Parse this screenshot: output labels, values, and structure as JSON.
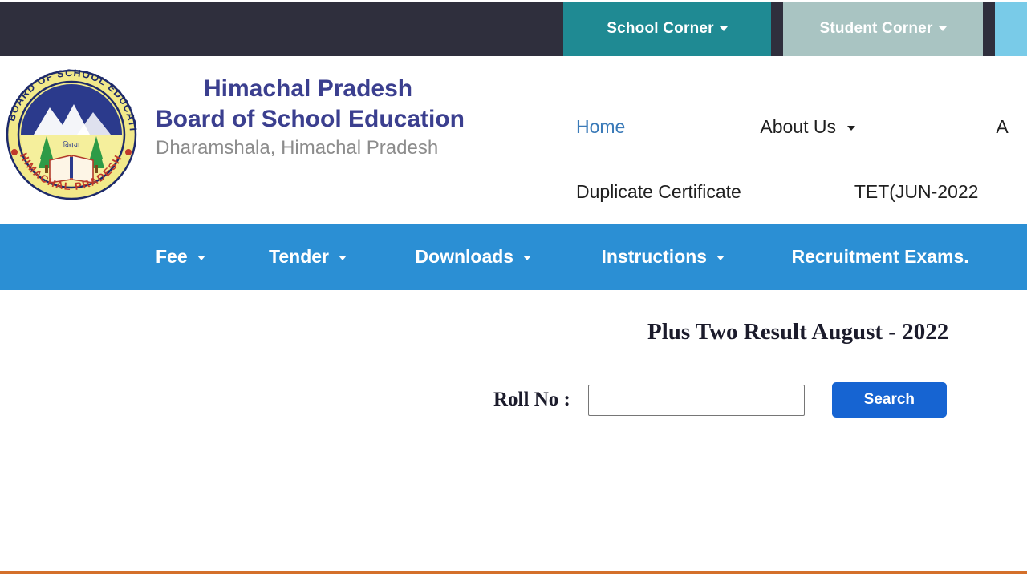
{
  "topbar": {
    "background": "#2f2f3d",
    "tabs": [
      {
        "label": "School Corner",
        "icon": "chevron-down-icon",
        "bg": "#1f8a93"
      },
      {
        "label": "Student Corner",
        "icon": "chevron-down-icon",
        "bg": "#a9c4c2"
      }
    ]
  },
  "brand": {
    "emblem_name": "hpbose-board-emblem",
    "emblem_outer_text_top": "BOARD OF SCHOOL EDUCATION",
    "emblem_outer_text_bottom": "HIMACHAL PRADESH",
    "line1": "Himachal Pradesh",
    "line2": "Board of School Education",
    "line3": "Dharamshala, Himachal Pradesh",
    "color_primary": "#3b3f8f",
    "color_secondary": "#8c8c8c"
  },
  "header_nav": {
    "row1": [
      {
        "label": "Home",
        "has_caret": false,
        "is_link": true
      },
      {
        "label": "About Us",
        "has_caret": true,
        "is_link": false
      },
      {
        "label": "A",
        "has_caret": false,
        "is_link": false
      }
    ],
    "row2": [
      {
        "label": "Duplicate Certificate",
        "has_caret": false
      },
      {
        "label": "TET(JUN-2022",
        "has_caret": false
      }
    ]
  },
  "blue_menu": {
    "background": "#2b8fd4",
    "items": [
      {
        "label": "Fee",
        "has_caret": true
      },
      {
        "label": "Tender",
        "has_caret": true
      },
      {
        "label": "Downloads",
        "has_caret": true
      },
      {
        "label": "Instructions",
        "has_caret": true
      },
      {
        "label": "Recruitment Exams.",
        "has_caret": false
      }
    ]
  },
  "main": {
    "result_title": "Plus Two Result August - 2022",
    "roll_label": "Roll No :",
    "roll_value": "",
    "roll_placeholder": "",
    "search_label": "Search",
    "search_button_color": "#1664d2"
  },
  "footer": {
    "rule_color": "#d4702a"
  }
}
